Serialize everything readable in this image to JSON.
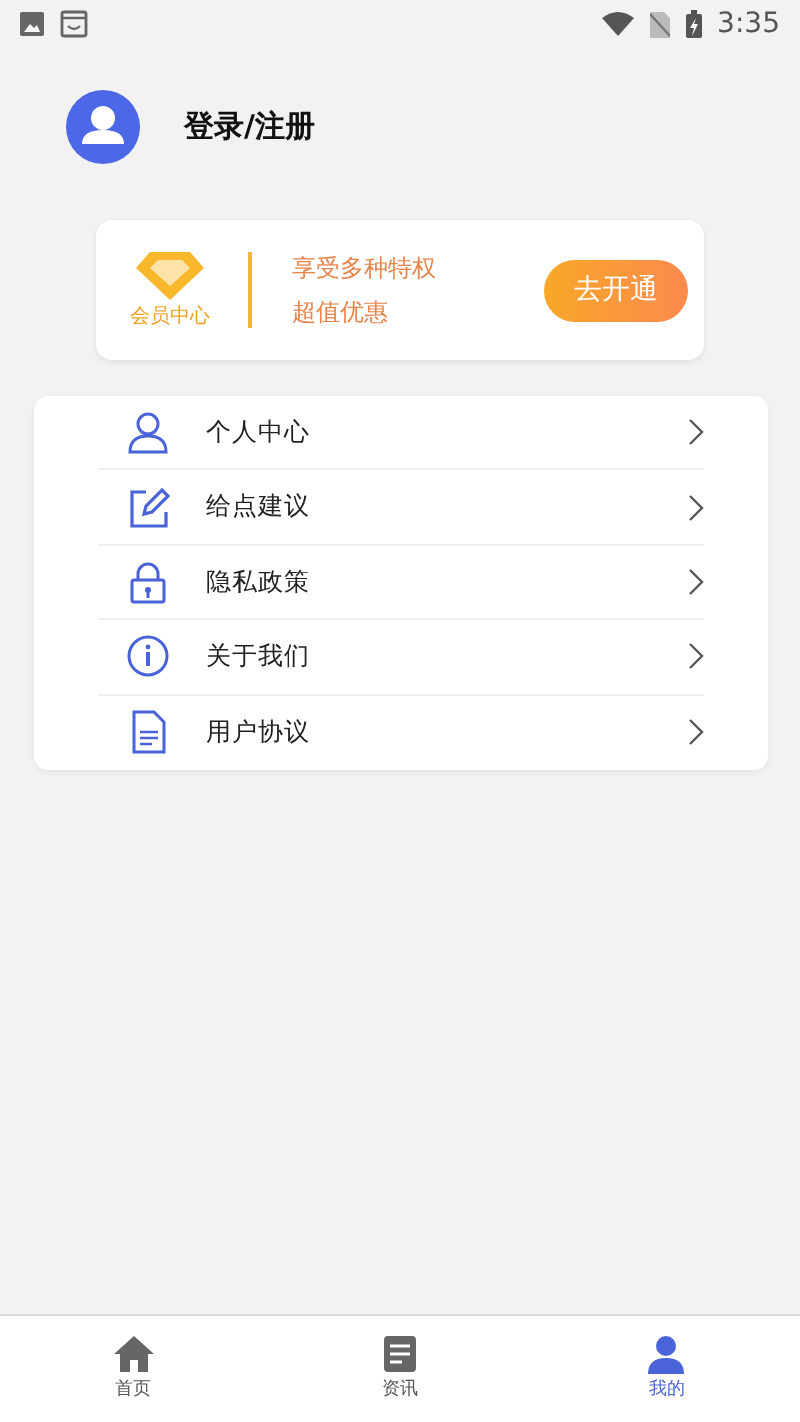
{
  "status_bar": {
    "time": "3:35"
  },
  "profile": {
    "login_label": "登录/注册"
  },
  "vip_card": {
    "badge_label": "会员中心",
    "lines": [
      "享受多种特权",
      "超值优惠"
    ],
    "button": "去开通"
  },
  "menu": [
    {
      "kind": "person",
      "label": "个人中心"
    },
    {
      "kind": "edit",
      "label": "给点建议"
    },
    {
      "kind": "lock",
      "label": "隐私政策"
    },
    {
      "kind": "info",
      "label": "关于我们"
    },
    {
      "kind": "document",
      "label": "用户协议"
    }
  ],
  "bottom_nav": [
    {
      "kind": "home",
      "label": "首页",
      "selected": false
    },
    {
      "kind": "news",
      "label": "资讯",
      "selected": false
    },
    {
      "kind": "person",
      "label": "我的",
      "selected": true
    }
  ]
}
